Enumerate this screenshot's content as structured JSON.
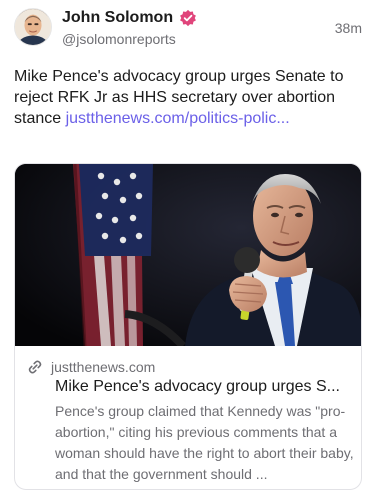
{
  "author": {
    "name": "John Solomon",
    "handle": "@jsolomonreports",
    "avatar": "avatar",
    "verified_icon": "verified-badge-icon",
    "verified_color": "#e0457b"
  },
  "time": "38m",
  "post": {
    "text": "Mike Pence's advocacy group urges Senate to reject RFK Jr as HHS secretary over abortion stance ",
    "link_text": "justthenews.com/politics-polic..."
  },
  "card": {
    "domain": "justthenews.com",
    "title": "Mike Pence's advocacy group urges S...",
    "description": "Pence's group claimed that Kennedy was \"pro-abortion,\" citing his previous comments that a woman should have the right to abort their baby, and that the government should ...",
    "link_icon": "link-icon"
  },
  "colors": {
    "link": "#6b60e8",
    "muted": "#6e6e73",
    "card_border": "#e2e2e6"
  }
}
